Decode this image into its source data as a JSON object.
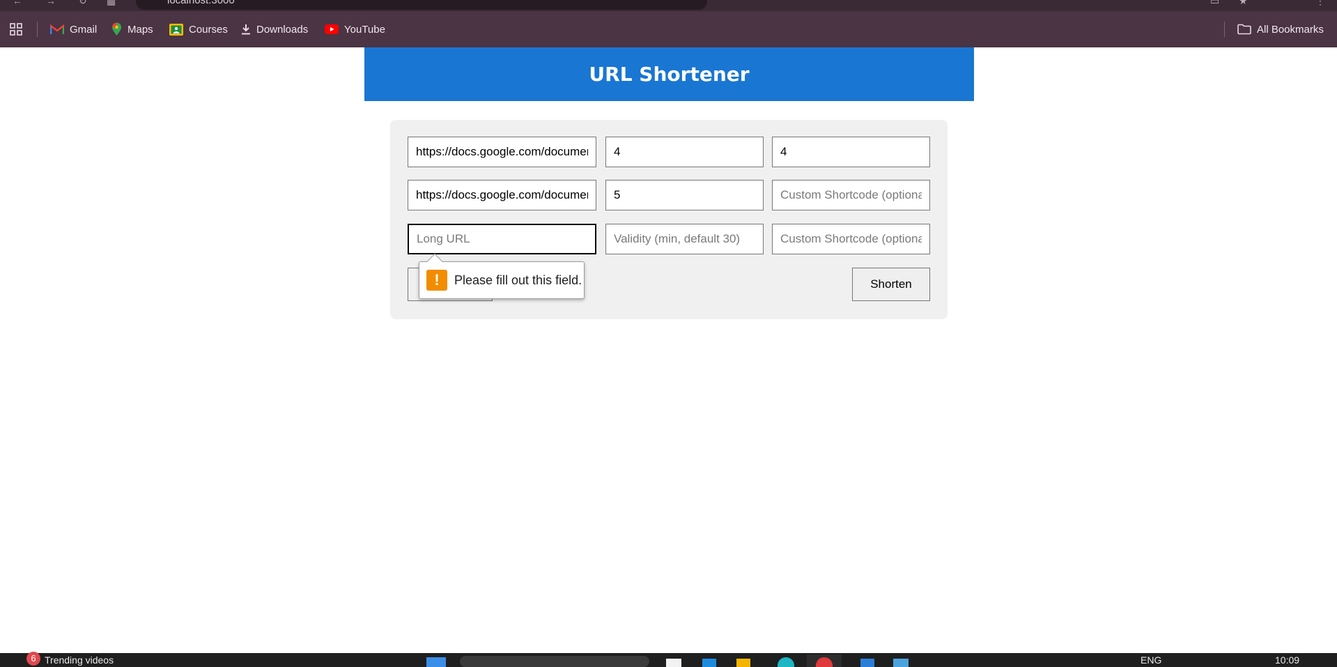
{
  "browser": {
    "address": "localhost:3000",
    "bookmarks": [
      {
        "label": "Gmail",
        "icon": "gmail-icon"
      },
      {
        "label": "Maps",
        "icon": "maps-icon"
      },
      {
        "label": "Courses",
        "icon": "courses-icon"
      },
      {
        "label": "Downloads",
        "icon": "download-icon"
      },
      {
        "label": "YouTube",
        "icon": "youtube-icon"
      }
    ],
    "all_bookmarks": "All Bookmarks"
  },
  "app": {
    "title": "URL Shortener",
    "header_color": "#1976d2"
  },
  "form": {
    "rows": [
      {
        "long_url": "https://docs.google.com/document",
        "validity": "4",
        "shortcode": "4"
      },
      {
        "long_url": "https://docs.google.com/document",
        "validity": "5",
        "shortcode": ""
      },
      {
        "long_url": "",
        "validity": "",
        "shortcode": ""
      }
    ],
    "placeholders": {
      "long_url": "Long URL",
      "validity": "Validity (min, default 30)",
      "shortcode": "Custom Shortcode (optional)"
    },
    "shorten_label": "Shorten",
    "validation_message": "Please fill out this field."
  },
  "taskbar": {
    "notification_count": "6",
    "news_label": "Trending videos",
    "lang": "ENG",
    "time": "10:09"
  }
}
